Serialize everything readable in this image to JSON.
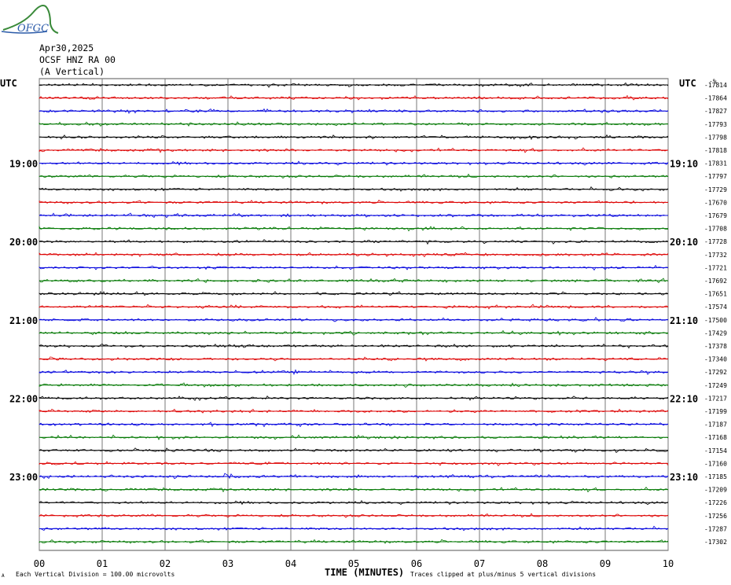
{
  "header": {
    "logo_text": "OFGC",
    "date": "Apr30,2025",
    "station": "OCSF HNZ RA 00",
    "component": "(A Vertical)"
  },
  "chart_data": {
    "type": "line",
    "left_axis_label": "UTC",
    "right_axis_label": "UTC",
    "right_top_label": "-%",
    "left_hour_labels": [
      "19:00",
      "20:00",
      "21:00",
      "22:00",
      "23:00"
    ],
    "right_hour_labels": [
      "19:10",
      "20:10",
      "21:10",
      "22:10",
      "23:10"
    ],
    "x_ticks": [
      "00",
      "01",
      "02",
      "03",
      "04",
      "05",
      "06",
      "07",
      "08",
      "09",
      "10"
    ],
    "xlabel": "TIME (MINUTES)",
    "xlim": [
      0,
      10
    ],
    "footer_left": "Each Vertical Division =  100.00 microvolts",
    "footer_right": "Traces clipped at plus/minus 5 vertical divisions",
    "footer_mark": "A",
    "trace_colors": [
      "#000000",
      "#dd0000",
      "#0000dd",
      "#007700"
    ],
    "trace_offsets": [
      -17814,
      -17864,
      -17827,
      -17793,
      -17798,
      -17818,
      -17831,
      -17797,
      -17729,
      -17670,
      -17679,
      -17708,
      -17728,
      -17732,
      -17721,
      -17692,
      -17651,
      -17574,
      -17500,
      -17429,
      -17378,
      -17340,
      -17292,
      -17249,
      -17217,
      -17199,
      -17187,
      -17168,
      -17154,
      -17160,
      -17185,
      -17209,
      -17226,
      -17256,
      -17287,
      -17302
    ]
  }
}
